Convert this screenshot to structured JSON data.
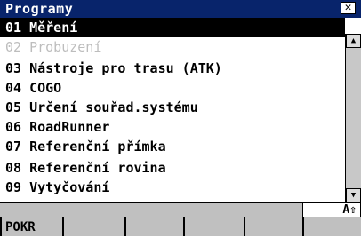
{
  "window": {
    "title": "Programy",
    "close_icon": "close-icon",
    "close_glyph": "✕"
  },
  "programs": [
    {
      "label": "01 Měření",
      "state": "selected"
    },
    {
      "label": "02 Probuzení",
      "state": "disabled"
    },
    {
      "label": "03 Nástroje pro trasu (ATK)",
      "state": "normal"
    },
    {
      "label": "04 COGO",
      "state": "normal"
    },
    {
      "label": "05 Určení souřad.systému",
      "state": "normal"
    },
    {
      "label": "06 RoadRunner",
      "state": "normal"
    },
    {
      "label": "07 Referenční přímka",
      "state": "normal"
    },
    {
      "label": "08 Referenční rovina",
      "state": "normal"
    },
    {
      "label": "09 Vytyčování",
      "state": "normal"
    }
  ],
  "scrollbar": {
    "up_glyph": "▲",
    "down_glyph": "▼"
  },
  "status": {
    "input_mode": "A⇧"
  },
  "softkeys": [
    {
      "label": "POKR"
    },
    {
      "label": ""
    },
    {
      "label": ""
    },
    {
      "label": ""
    },
    {
      "label": ""
    },
    {
      "label": ""
    }
  ]
}
